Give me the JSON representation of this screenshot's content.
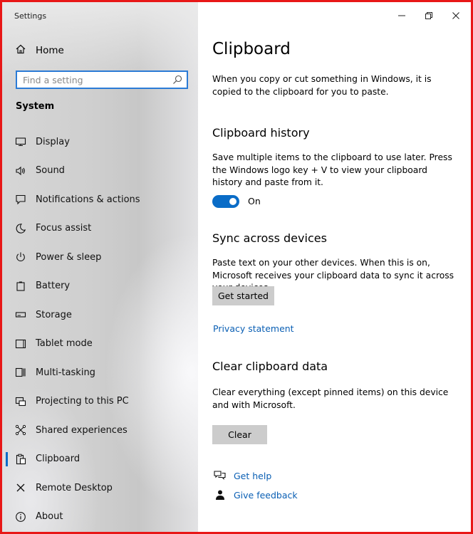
{
  "window": {
    "title": "Settings"
  },
  "sidebar": {
    "home_label": "Home",
    "search_placeholder": "Find a setting",
    "section": "System",
    "items": [
      {
        "label": "Display",
        "icon": "display-icon"
      },
      {
        "label": "Sound",
        "icon": "speaker-icon"
      },
      {
        "label": "Notifications & actions",
        "icon": "notification-icon"
      },
      {
        "label": "Focus assist",
        "icon": "moon-icon"
      },
      {
        "label": "Power & sleep",
        "icon": "power-icon"
      },
      {
        "label": "Battery",
        "icon": "battery-icon"
      },
      {
        "label": "Storage",
        "icon": "storage-icon"
      },
      {
        "label": "Tablet mode",
        "icon": "tablet-icon"
      },
      {
        "label": "Multi-tasking",
        "icon": "multitasking-icon"
      },
      {
        "label": "Projecting to this PC",
        "icon": "projecting-icon"
      },
      {
        "label": "Shared experiences",
        "icon": "shared-icon"
      },
      {
        "label": "Clipboard",
        "icon": "clipboard-icon",
        "active": true
      },
      {
        "label": "Remote Desktop",
        "icon": "remote-icon"
      },
      {
        "label": "About",
        "icon": "info-icon"
      }
    ]
  },
  "main": {
    "title": "Clipboard",
    "intro": "When you copy or cut something in Windows, it is copied to the clipboard for you to paste.",
    "history": {
      "heading": "Clipboard history",
      "description": "Save multiple items to the clipboard to use later. Press the Windows logo key + V to view your clipboard history and paste from it.",
      "toggle_state": "On"
    },
    "sync": {
      "heading": "Sync across devices",
      "description": "Paste text on your other devices. When this is on, Microsoft receives your clipboard data to sync it across your devices.",
      "button": "Get started",
      "privacy_link": "Privacy statement"
    },
    "clear": {
      "heading": "Clear clipboard data",
      "description": "Clear everything (except pinned items) on this device and with Microsoft.",
      "button": "Clear"
    },
    "help": {
      "get_help": "Get help",
      "give_feedback": "Give feedback"
    }
  },
  "colors": {
    "accent": "#0a6cc7",
    "link": "#0a5fb4",
    "button": "#cccccc",
    "border": "#e81717"
  }
}
